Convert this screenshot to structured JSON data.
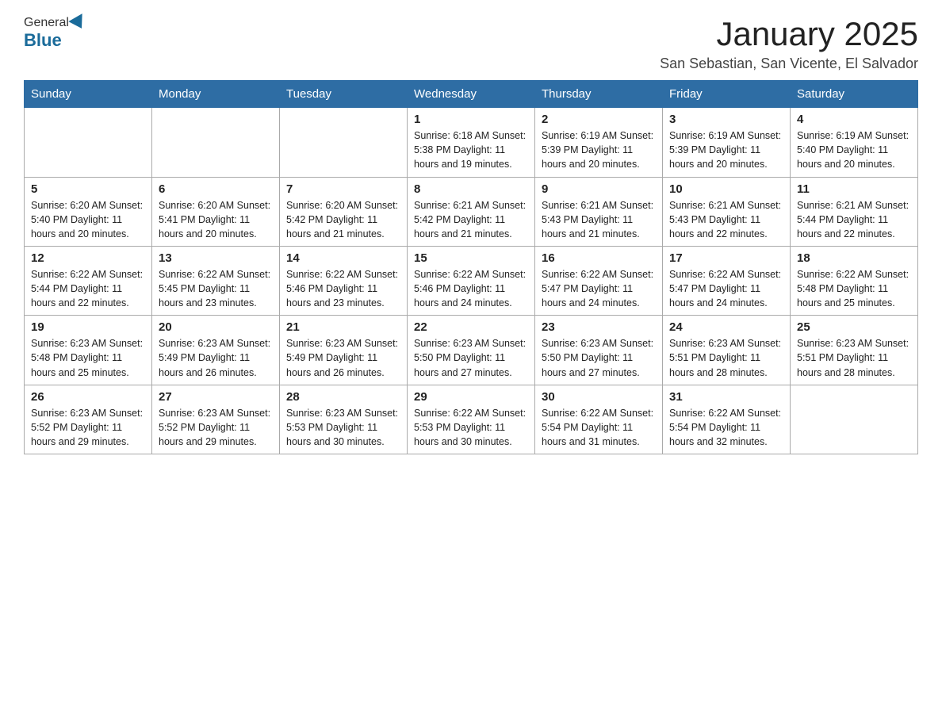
{
  "header": {
    "logo_general": "General",
    "logo_blue": "Blue",
    "month_title": "January 2025",
    "location": "San Sebastian, San Vicente, El Salvador"
  },
  "days_of_week": [
    "Sunday",
    "Monday",
    "Tuesday",
    "Wednesday",
    "Thursday",
    "Friday",
    "Saturday"
  ],
  "weeks": [
    [
      {
        "day": "",
        "info": ""
      },
      {
        "day": "",
        "info": ""
      },
      {
        "day": "",
        "info": ""
      },
      {
        "day": "1",
        "info": "Sunrise: 6:18 AM\nSunset: 5:38 PM\nDaylight: 11 hours\nand 19 minutes."
      },
      {
        "day": "2",
        "info": "Sunrise: 6:19 AM\nSunset: 5:39 PM\nDaylight: 11 hours\nand 20 minutes."
      },
      {
        "day": "3",
        "info": "Sunrise: 6:19 AM\nSunset: 5:39 PM\nDaylight: 11 hours\nand 20 minutes."
      },
      {
        "day": "4",
        "info": "Sunrise: 6:19 AM\nSunset: 5:40 PM\nDaylight: 11 hours\nand 20 minutes."
      }
    ],
    [
      {
        "day": "5",
        "info": "Sunrise: 6:20 AM\nSunset: 5:40 PM\nDaylight: 11 hours\nand 20 minutes."
      },
      {
        "day": "6",
        "info": "Sunrise: 6:20 AM\nSunset: 5:41 PM\nDaylight: 11 hours\nand 20 minutes."
      },
      {
        "day": "7",
        "info": "Sunrise: 6:20 AM\nSunset: 5:42 PM\nDaylight: 11 hours\nand 21 minutes."
      },
      {
        "day": "8",
        "info": "Sunrise: 6:21 AM\nSunset: 5:42 PM\nDaylight: 11 hours\nand 21 minutes."
      },
      {
        "day": "9",
        "info": "Sunrise: 6:21 AM\nSunset: 5:43 PM\nDaylight: 11 hours\nand 21 minutes."
      },
      {
        "day": "10",
        "info": "Sunrise: 6:21 AM\nSunset: 5:43 PM\nDaylight: 11 hours\nand 22 minutes."
      },
      {
        "day": "11",
        "info": "Sunrise: 6:21 AM\nSunset: 5:44 PM\nDaylight: 11 hours\nand 22 minutes."
      }
    ],
    [
      {
        "day": "12",
        "info": "Sunrise: 6:22 AM\nSunset: 5:44 PM\nDaylight: 11 hours\nand 22 minutes."
      },
      {
        "day": "13",
        "info": "Sunrise: 6:22 AM\nSunset: 5:45 PM\nDaylight: 11 hours\nand 23 minutes."
      },
      {
        "day": "14",
        "info": "Sunrise: 6:22 AM\nSunset: 5:46 PM\nDaylight: 11 hours\nand 23 minutes."
      },
      {
        "day": "15",
        "info": "Sunrise: 6:22 AM\nSunset: 5:46 PM\nDaylight: 11 hours\nand 24 minutes."
      },
      {
        "day": "16",
        "info": "Sunrise: 6:22 AM\nSunset: 5:47 PM\nDaylight: 11 hours\nand 24 minutes."
      },
      {
        "day": "17",
        "info": "Sunrise: 6:22 AM\nSunset: 5:47 PM\nDaylight: 11 hours\nand 24 minutes."
      },
      {
        "day": "18",
        "info": "Sunrise: 6:22 AM\nSunset: 5:48 PM\nDaylight: 11 hours\nand 25 minutes."
      }
    ],
    [
      {
        "day": "19",
        "info": "Sunrise: 6:23 AM\nSunset: 5:48 PM\nDaylight: 11 hours\nand 25 minutes."
      },
      {
        "day": "20",
        "info": "Sunrise: 6:23 AM\nSunset: 5:49 PM\nDaylight: 11 hours\nand 26 minutes."
      },
      {
        "day": "21",
        "info": "Sunrise: 6:23 AM\nSunset: 5:49 PM\nDaylight: 11 hours\nand 26 minutes."
      },
      {
        "day": "22",
        "info": "Sunrise: 6:23 AM\nSunset: 5:50 PM\nDaylight: 11 hours\nand 27 minutes."
      },
      {
        "day": "23",
        "info": "Sunrise: 6:23 AM\nSunset: 5:50 PM\nDaylight: 11 hours\nand 27 minutes."
      },
      {
        "day": "24",
        "info": "Sunrise: 6:23 AM\nSunset: 5:51 PM\nDaylight: 11 hours\nand 28 minutes."
      },
      {
        "day": "25",
        "info": "Sunrise: 6:23 AM\nSunset: 5:51 PM\nDaylight: 11 hours\nand 28 minutes."
      }
    ],
    [
      {
        "day": "26",
        "info": "Sunrise: 6:23 AM\nSunset: 5:52 PM\nDaylight: 11 hours\nand 29 minutes."
      },
      {
        "day": "27",
        "info": "Sunrise: 6:23 AM\nSunset: 5:52 PM\nDaylight: 11 hours\nand 29 minutes."
      },
      {
        "day": "28",
        "info": "Sunrise: 6:23 AM\nSunset: 5:53 PM\nDaylight: 11 hours\nand 30 minutes."
      },
      {
        "day": "29",
        "info": "Sunrise: 6:22 AM\nSunset: 5:53 PM\nDaylight: 11 hours\nand 30 minutes."
      },
      {
        "day": "30",
        "info": "Sunrise: 6:22 AM\nSunset: 5:54 PM\nDaylight: 11 hours\nand 31 minutes."
      },
      {
        "day": "31",
        "info": "Sunrise: 6:22 AM\nSunset: 5:54 PM\nDaylight: 11 hours\nand 32 minutes."
      },
      {
        "day": "",
        "info": ""
      }
    ]
  ]
}
